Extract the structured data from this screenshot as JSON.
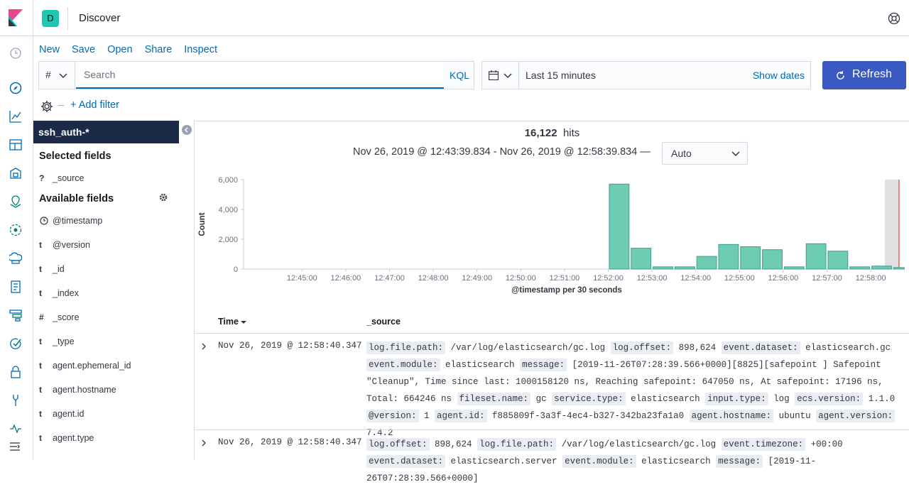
{
  "app": {
    "space_initial": "D",
    "title": "Discover"
  },
  "top_menu": [
    "New",
    "Save",
    "Open",
    "Share",
    "Inspect"
  ],
  "query": {
    "language_symbol": "#",
    "placeholder": "Search",
    "language_label": "KQL"
  },
  "date": {
    "range": "Last 15 minutes",
    "show_dates_label": "Show dates"
  },
  "refresh_label": "Refresh",
  "add_filter_label": "+ Add filter",
  "sidebar": {
    "index_pattern": "ssh_auth-*",
    "selected_title": "Selected fields",
    "selected_fields": [
      {
        "type": "?",
        "name": "_source"
      }
    ],
    "available_title": "Available fields",
    "available_fields": [
      {
        "type": "clock",
        "name": "@timestamp"
      },
      {
        "type": "t",
        "name": "@version"
      },
      {
        "type": "t",
        "name": "_id"
      },
      {
        "type": "t",
        "name": "_index"
      },
      {
        "type": "#",
        "name": "_score"
      },
      {
        "type": "t",
        "name": "_type"
      },
      {
        "type": "t",
        "name": "agent.ephemeral_id"
      },
      {
        "type": "t",
        "name": "agent.hostname"
      },
      {
        "type": "t",
        "name": "agent.id"
      },
      {
        "type": "t",
        "name": "agent.type"
      }
    ]
  },
  "results": {
    "hits_count": "16,122",
    "hits_label": "hits",
    "time_range": "Nov 26, 2019 @ 12:43:39.834 - Nov 26, 2019 @ 12:58:39.834 —",
    "interval": "Auto"
  },
  "chart_data": {
    "type": "bar",
    "ylabel": "Count",
    "xlabel": "@timestamp per 30 seconds",
    "ylim": [
      0,
      6000
    ],
    "yticks": [
      "0",
      "2,000",
      "4,000",
      "6,000"
    ],
    "xticks": [
      "12:45:00",
      "12:46:00",
      "12:47:00",
      "12:48:00",
      "12:49:00",
      "12:50:00",
      "12:51:00",
      "12:52:00",
      "12:53:00",
      "12:54:00",
      "12:55:00",
      "12:56:00",
      "12:57:00",
      "12:58:00"
    ],
    "categories": [
      "12:52:00",
      "12:52:30",
      "12:53:00",
      "12:53:30",
      "12:54:00",
      "12:54:30",
      "12:55:00",
      "12:55:30",
      "12:56:00",
      "12:56:30",
      "12:57:00",
      "12:57:30",
      "12:58:00",
      "12:58:30"
    ],
    "values": [
      5700,
      1400,
      150,
      150,
      850,
      1650,
      1500,
      1300,
      150,
      1700,
      1200,
      150,
      200,
      100
    ],
    "bar_color": "#6dccb1",
    "bar_stroke": "#3b9e92"
  },
  "table": {
    "time_header": "Time",
    "source_header": "_source",
    "rows": [
      {
        "time": "Nov 26, 2019 @ 12:58:40.347",
        "fields": [
          {
            "k": "log.file.path:",
            "v": "/var/log/elasticsearch/gc.log"
          },
          {
            "k": "log.offset:",
            "v": "898,624"
          },
          {
            "k": "event.dataset:",
            "v": "elasticsearch.gc"
          },
          {
            "k": "event.module:",
            "v": "elasticsearch"
          },
          {
            "k": "message:",
            "v": "[2019-11-26T07:28:39.566+0000][8825][safepoint ] Safepoint \"Cleanup\", Time since last: 1000158120 ns, Reaching safepoint: 647050 ns, At safepoint: 17196 ns, Total: 664246 ns"
          },
          {
            "k": "fileset.name:",
            "v": "gc"
          },
          {
            "k": "service.type:",
            "v": "elasticsearch"
          },
          {
            "k": "input.type:",
            "v": "log"
          },
          {
            "k": "ecs.version:",
            "v": "1.1.0"
          },
          {
            "k": "@version:",
            "v": "1"
          },
          {
            "k": "agent.id:",
            "v": "f885809f-3a3f-4ec4-b327-342ba23fa1a0"
          },
          {
            "k": "agent.hostname:",
            "v": "ubuntu"
          },
          {
            "k": "agent.version:",
            "v": "7.4.2"
          }
        ]
      },
      {
        "time": "Nov 26, 2019 @ 12:58:40.347",
        "fields": [
          {
            "k": "log.offset:",
            "v": "898,624"
          },
          {
            "k": "log.file.path:",
            "v": "/var/log/elasticsearch/gc.log"
          },
          {
            "k": "event.timezone:",
            "v": "+00:00"
          },
          {
            "k": "event.dataset:",
            "v": "elasticsearch.server"
          },
          {
            "k": "event.module:",
            "v": "elasticsearch"
          },
          {
            "k": "message:",
            "v": "[2019-11-26T07:28:39.566+0000]"
          }
        ]
      }
    ]
  }
}
